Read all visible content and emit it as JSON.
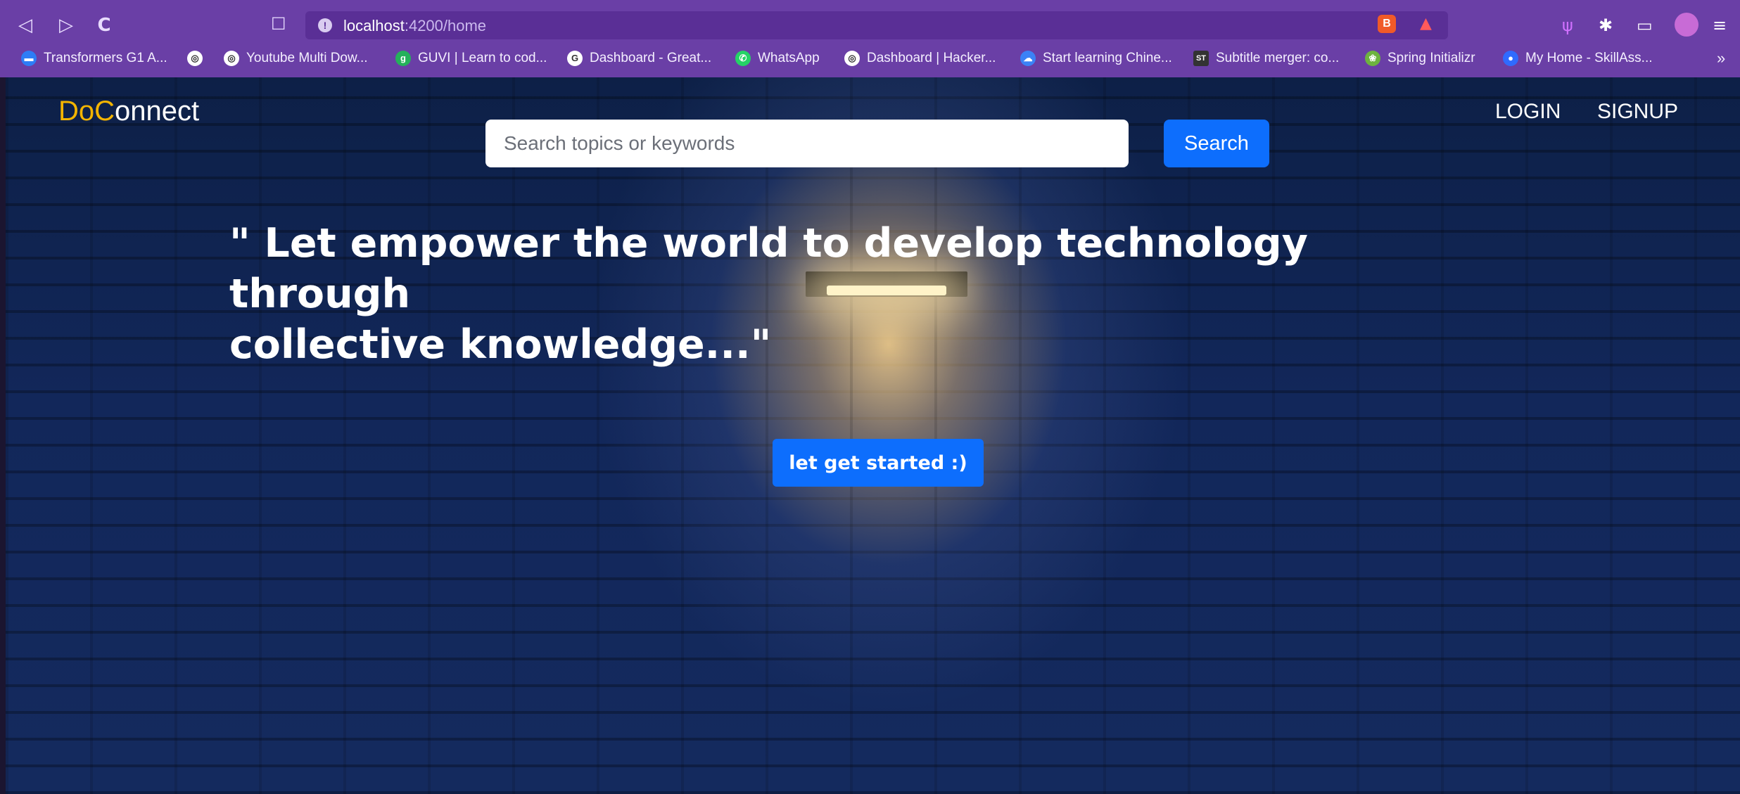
{
  "browser": {
    "url_host": "localhost",
    "url_rest": ":4200/home",
    "back_icon": "◁",
    "forward_icon": "▷",
    "reload_icon": "C",
    "bookmarks": [
      {
        "label": "Transformers G1 A...",
        "icon": "tf-icon",
        "color": "#2d7df6"
      },
      {
        "label": "",
        "icon": "globe-icon",
        "color": "#ffffff"
      },
      {
        "label": "Youtube Multi Dow...",
        "icon": "globe-icon",
        "color": "#ffffff"
      },
      {
        "label": "GUVI | Learn to cod...",
        "icon": "guvi-icon",
        "color": "#25b15b"
      },
      {
        "label": "Dashboard - Great...",
        "icon": "great-icon",
        "color": "#ffffff"
      },
      {
        "label": "WhatsApp",
        "icon": "whatsapp-icon",
        "color": "#25d366"
      },
      {
        "label": "Dashboard | Hacker...",
        "icon": "globe-icon",
        "color": "#ffffff"
      },
      {
        "label": "Start learning Chine...",
        "icon": "chinese-icon",
        "color": "#3b82f6"
      },
      {
        "label": "Subtitle merger: co...",
        "icon": "st-icon",
        "color": "#333333"
      },
      {
        "label": "Spring Initializr",
        "icon": "spring-icon",
        "color": "#6db33f"
      },
      {
        "label": "My Home - SkillAss...",
        "icon": "skill-icon",
        "color": "#2f6bff"
      }
    ],
    "more_bookmarks": "»"
  },
  "header": {
    "logo_do": "Do",
    "logo_c": "C",
    "logo_rest": "onnect",
    "search_placeholder": "Search topics or keywords",
    "search_button": "Search",
    "login": "LOGIN",
    "signup": "SIGNUP"
  },
  "hero": {
    "quote_line1": "\" Let empower the world to develop technology through",
    "quote_line2": "collective knowledge...\"",
    "cta": "let get started :)"
  },
  "colors": {
    "browser_chrome": "#6a3fa6",
    "primary_button": "#0d6efd",
    "logo_accent": "#f3b400",
    "background": "#12275a"
  }
}
